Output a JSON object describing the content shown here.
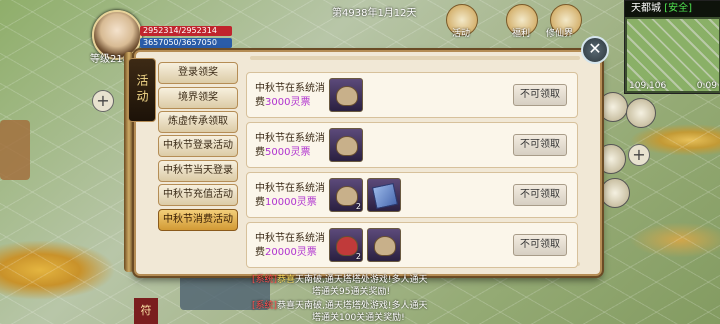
{
  "player": {
    "level_text": "等级218",
    "hp": "2952314/2952314",
    "mp": "3657050/3657050"
  },
  "game_date": "第4938年1月12天",
  "top_icons": [
    "活动",
    "福利",
    "修仙界"
  ],
  "minimap": {
    "title": "天都城",
    "status": "[安全]",
    "coords": "109,106",
    "time": "0:09"
  },
  "panel": {
    "tab_label": "活动",
    "sidebar": [
      {
        "label": "登录领奖",
        "active": false
      },
      {
        "label": "境界领奖",
        "active": false
      },
      {
        "label": "炼虚传承领取",
        "active": false
      },
      {
        "label": "中秋节登录活动",
        "active": false
      },
      {
        "label": "中秋节当天登录",
        "active": false
      },
      {
        "label": "中秋节充值活动",
        "active": false
      },
      {
        "label": "中秋节消费活动",
        "active": true
      }
    ],
    "rewards": [
      {
        "text_a": "中秋节在系统消",
        "text_b": "费",
        "amount": "3000灵票",
        "items": [
          {
            "kind": "bag",
            "count": ""
          }
        ],
        "button": "不可领取"
      },
      {
        "text_a": "中秋节在系统消",
        "text_b": "费",
        "amount": "5000灵票",
        "items": [
          {
            "kind": "bag",
            "count": ""
          }
        ],
        "button": "不可领取"
      },
      {
        "text_a": "中秋节在系统消",
        "text_b": "费",
        "amount": "10000灵票",
        "items": [
          {
            "kind": "bag",
            "count": "2"
          },
          {
            "kind": "book",
            "count": ""
          }
        ],
        "button": "不可领取"
      },
      {
        "text_a": "中秋节在系统消",
        "text_b": "费",
        "amount": "20000灵票",
        "items": [
          {
            "kind": "bag-red",
            "count": "2"
          },
          {
            "kind": "bag",
            "count": ""
          }
        ],
        "button": "不可领取"
      }
    ]
  },
  "chat": {
    "line1_tag": "[系统]",
    "line1_hl": "恭喜",
    "line1_rest": "天南破,通天塔塔处游戏!多人通天",
    "line2": "塔通关95通关奖励!",
    "line3_tag": "[系统]",
    "line3_rest": "恭喜天南破,通天塔塔处游戏!多人通天",
    "line4": "塔通关100关通关奖励!"
  },
  "bottom_btn": "符"
}
